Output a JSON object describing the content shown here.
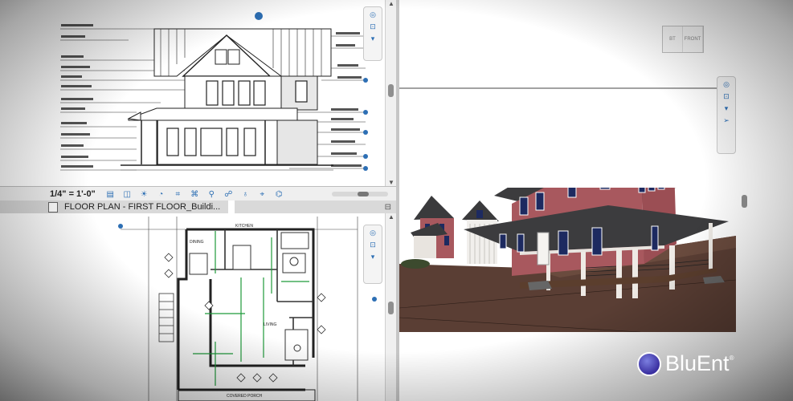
{
  "elevation_view": {
    "scale_label": "1/4\" = 1'-0\""
  },
  "plan_view": {
    "tab_title": "FLOOR PLAN - FIRST FLOOR_Buildi...",
    "room_labels": {
      "kitchen": "KITCHEN",
      "dining": "DINING",
      "living": "LIVING",
      "porch": "COVERED PORCH"
    }
  },
  "view3d": {
    "viewcube_faces": [
      "BT",
      "FRONT"
    ]
  },
  "logo": {
    "brand": "BluEnt",
    "reg": "®"
  },
  "colors": {
    "house_wall": "#a8585e",
    "roof": "#3c3c3e",
    "ground": "#5a3e34",
    "accent_blue": "#2d6fb4"
  }
}
